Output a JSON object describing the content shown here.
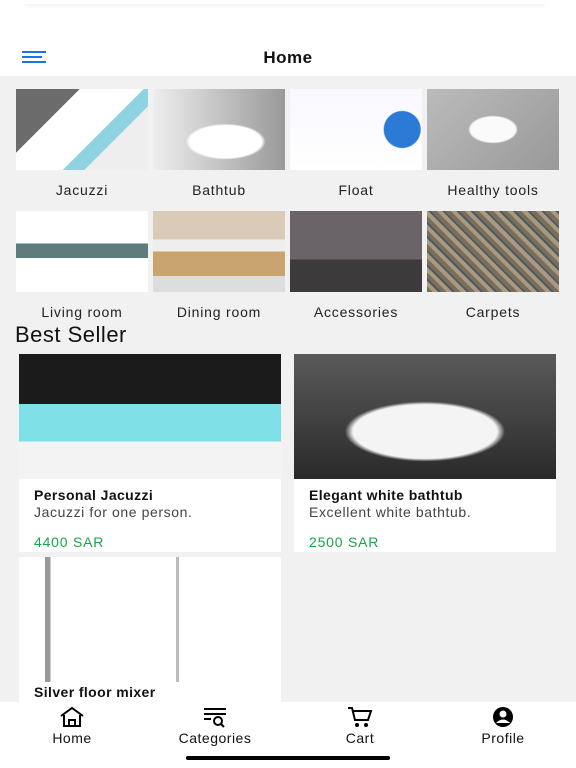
{
  "header": {
    "title": "Home",
    "menu_icon": "hamburger-icon",
    "accent": "#1a73e8"
  },
  "categories": [
    {
      "label": "Jacuzzi"
    },
    {
      "label": "Bathtub"
    },
    {
      "label": "Float"
    },
    {
      "label": "Healthy tools"
    },
    {
      "label": "Living room"
    },
    {
      "label": "Dining room"
    },
    {
      "label": "Accessories"
    },
    {
      "label": "Carpets"
    }
  ],
  "best_seller": {
    "title": "Best Seller",
    "items": [
      {
        "name": "Personal Jacuzzi",
        "description": "Jacuzzi for one person.",
        "price": "4400 SAR"
      },
      {
        "name": "Elegant white bathtub",
        "description": "Excellent white bathtub.",
        "price": "2500 SAR"
      },
      {
        "name": "Silver floor mixer"
      }
    ],
    "price_color": "#1aa34a"
  },
  "tabs": [
    {
      "label": "Home",
      "icon": "home-icon"
    },
    {
      "label": "Categories",
      "icon": "categories-search-icon"
    },
    {
      "label": "Cart",
      "icon": "cart-icon"
    },
    {
      "label": "Profile",
      "icon": "profile-icon"
    }
  ]
}
